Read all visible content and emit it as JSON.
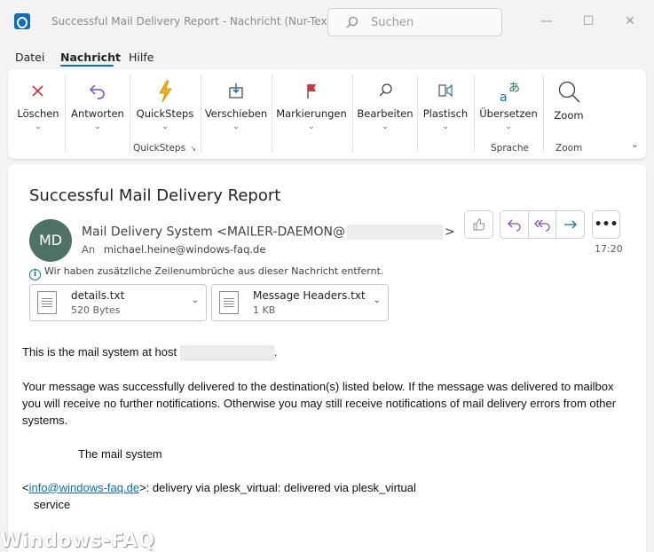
{
  "window": {
    "title": "Successful Mail Delivery Report  -  Nachricht (Nur-Text)",
    "search_placeholder": "Suchen",
    "minimize": "—",
    "maximize": "☐",
    "close": "✕"
  },
  "menu": {
    "items": [
      "Datei",
      "Nachricht",
      "Hilfe"
    ],
    "active": "Nachricht"
  },
  "ribbon": {
    "groups": [
      {
        "name": "delete",
        "buttons": [
          {
            "label": "Löschen",
            "icon": "delete-x-icon"
          }
        ]
      },
      {
        "name": "respond",
        "buttons": [
          {
            "label": "Antworten",
            "icon": "reply-icon"
          }
        ]
      },
      {
        "name": "quicksteps",
        "label": "QuickSteps",
        "buttons": [
          {
            "label": "QuickSteps",
            "icon": "lightning-icon"
          }
        ]
      },
      {
        "name": "move",
        "buttons": [
          {
            "label": "Verschieben",
            "icon": "move-icon"
          }
        ]
      },
      {
        "name": "tags",
        "buttons": [
          {
            "label": "Markierungen",
            "icon": "flag-icon"
          }
        ]
      },
      {
        "name": "edit",
        "buttons": [
          {
            "label": "Bearbeiten",
            "icon": "search-icon"
          }
        ]
      },
      {
        "name": "immersive",
        "buttons": [
          {
            "label": "Plastisch",
            "icon": "immersive-reader-icon"
          }
        ]
      },
      {
        "name": "language",
        "label": "Sprache",
        "buttons": [
          {
            "label": "Übersetzen",
            "icon": "translate-icon"
          }
        ]
      },
      {
        "name": "zoom",
        "label": "Zoom",
        "buttons": [
          {
            "label": "Zoom",
            "icon": "zoom-icon"
          }
        ]
      }
    ]
  },
  "message": {
    "subject": "Successful Mail Delivery Report",
    "avatar_initials": "MD",
    "sender_prefix": "Mail Delivery System <MAILER-DAEMON@",
    "sender_suffix": ">",
    "to_label": "An",
    "to_address": "michael.heine@windows-faq.de",
    "info_text": "Wir haben zusätzliche Zeilenumbrüche aus dieser Nachricht entfernt.",
    "time": "17:20",
    "attachments": [
      {
        "name": "details.txt",
        "size": "520 Bytes"
      },
      {
        "name": "Message Headers.txt",
        "size": "1 KB"
      }
    ],
    "body": {
      "line1_prefix": "This is the mail system at host ",
      "line1_suffix": ".",
      "paragraph2": "Your message was successfully delivered to the destination(s) listed below. If the message was delivered to mailbox you will receive no further notifications. Otherwise you may still receive notifications of mail delivery errors from other systems.",
      "signature": "The mail system",
      "recipient_open": "<",
      "recipient_link": "info@windows-faq.de",
      "recipient_rest": ">: delivery via plesk_virtual: delivered via plesk_virtual",
      "recipient_cont": "service"
    }
  },
  "watermark": "Windows-FAQ",
  "colors": {
    "accent": "#0f6cbd",
    "reply_purple": "#7a4fc3",
    "avatar_bg": "#4e7265",
    "delete_red": "#d13438",
    "quicksteps_yellow": "#f2b01e"
  }
}
